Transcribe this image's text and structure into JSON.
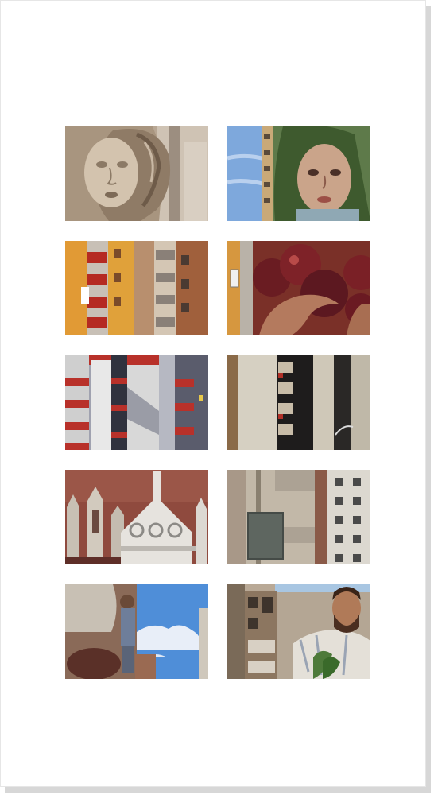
{
  "poster": {
    "background": "#ffffff",
    "shadow_color": "#d7d7d7"
  },
  "photos": [
    {
      "subject": "baroque-sculpted-face"
    },
    {
      "subject": "mural-woman-face"
    },
    {
      "subject": "orange-apartment-blocks"
    },
    {
      "subject": "mural-hands-red-apples"
    },
    {
      "subject": "red-balcony-tower-block"
    },
    {
      "subject": "beige-tower-dark-windows"
    },
    {
      "subject": "gothic-white-facade-red-wall"
    },
    {
      "subject": "grey-high-rise-with-sign"
    },
    {
      "subject": "mural-figure-and-blue-sky"
    },
    {
      "subject": "mural-bearded-man-building"
    }
  ]
}
